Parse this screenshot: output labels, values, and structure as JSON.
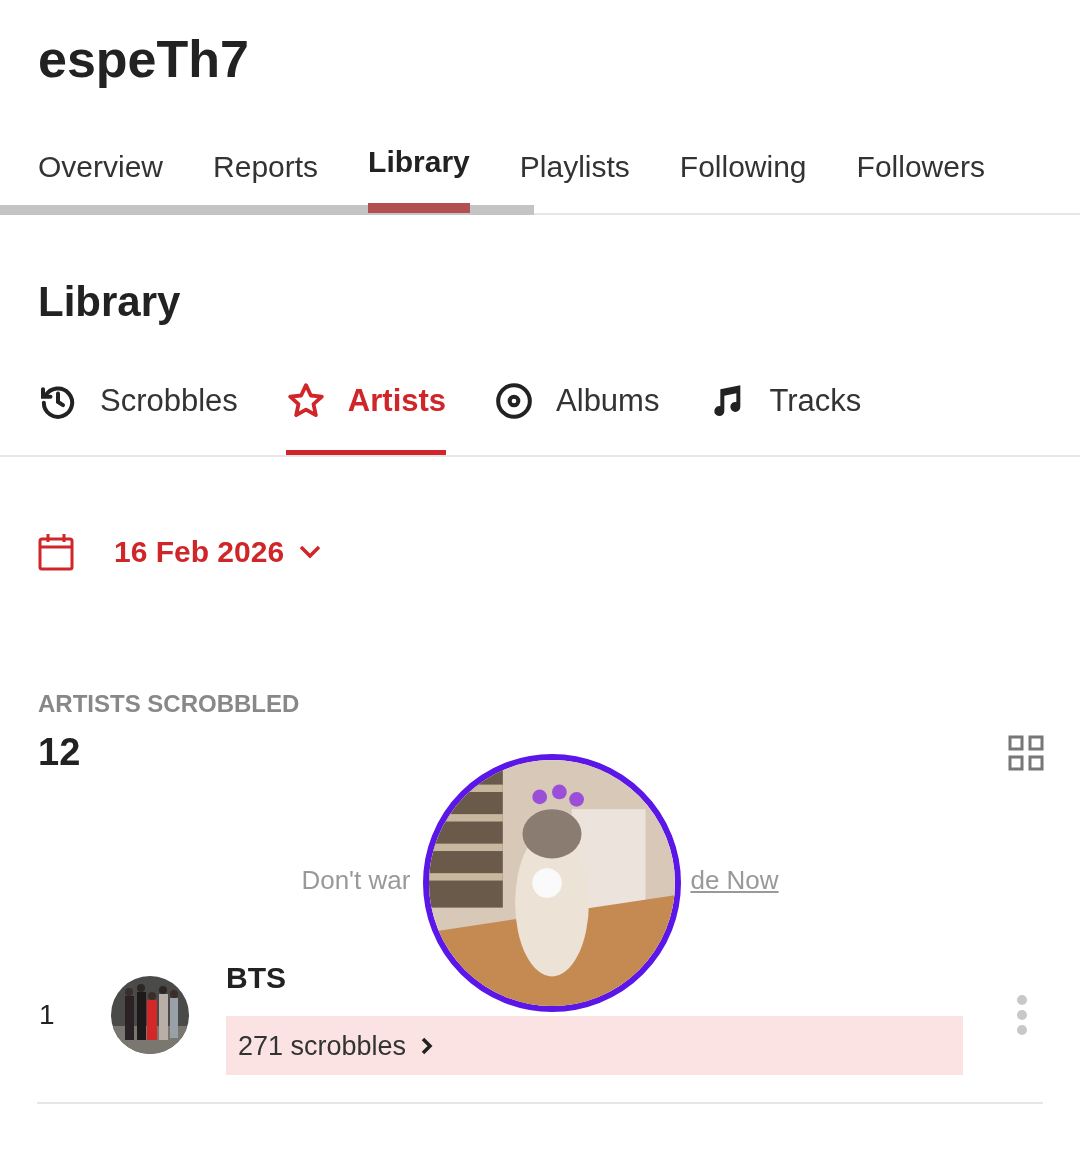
{
  "profile": {
    "username": "espeTh7"
  },
  "tabs": [
    {
      "label": "Overview",
      "selected": false
    },
    {
      "label": "Reports",
      "selected": false
    },
    {
      "label": "Library",
      "selected": true
    },
    {
      "label": "Playlists",
      "selected": false
    },
    {
      "label": "Following",
      "selected": false
    },
    {
      "label": "Followers",
      "selected": false
    }
  ],
  "section_title": "Library",
  "subtabs": [
    {
      "label": "Scrobbles",
      "kind": "history",
      "selected": false
    },
    {
      "label": "Artists",
      "kind": "star",
      "selected": true
    },
    {
      "label": "Albums",
      "kind": "disc",
      "selected": false
    },
    {
      "label": "Tracks",
      "kind": "note",
      "selected": false
    }
  ],
  "date_filter": {
    "label": "16 Feb 2026"
  },
  "stats": {
    "label": "ARTISTS SCROBBLED",
    "value": "12"
  },
  "ad_notice": {
    "text": "Don't war",
    "link": "de Now"
  },
  "artists": [
    {
      "rank": "1",
      "name": "BTS",
      "scrobbles": "271 scrobbles"
    }
  ]
}
